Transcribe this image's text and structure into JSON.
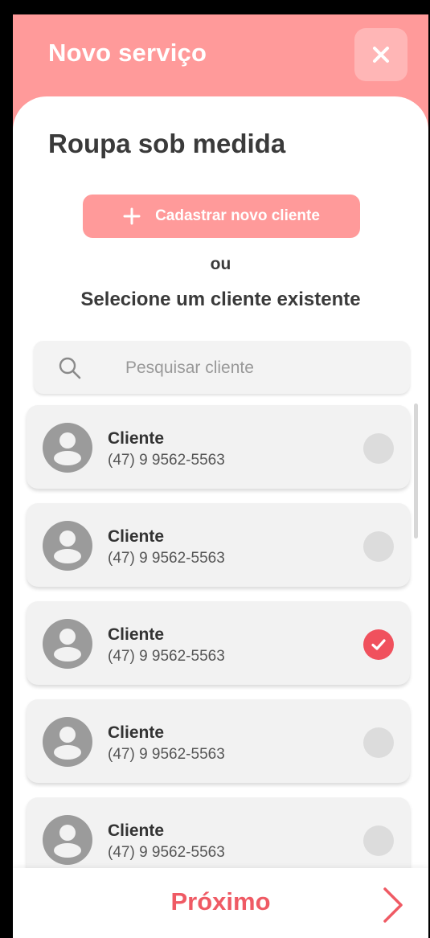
{
  "header": {
    "title": "Novo serviço",
    "close_icon": "close-icon"
  },
  "service": {
    "title": "Roupa sob medida"
  },
  "actions": {
    "add_client_label": "Cadastrar novo cliente",
    "add_icon": "plus-icon",
    "or_text": "ou",
    "select_text": "Selecione um cliente existente"
  },
  "search": {
    "placeholder": "Pesquisar cliente",
    "value": ""
  },
  "clients": [
    {
      "name": "Cliente",
      "phone": "(47) 9 9562-5563",
      "selected": false
    },
    {
      "name": "Cliente",
      "phone": "(47) 9 9562-5563",
      "selected": false
    },
    {
      "name": "Cliente",
      "phone": "(47) 9 9562-5563",
      "selected": true
    },
    {
      "name": "Cliente",
      "phone": "(47) 9 9562-5563",
      "selected": false
    },
    {
      "name": "Cliente",
      "phone": "(47) 9 9562-5563",
      "selected": false
    }
  ],
  "footer": {
    "next_label": "Próximo",
    "next_icon": "chevron-right-icon"
  },
  "colors": {
    "brand_pink": "#ff9a9a",
    "accent_red": "#f0515d",
    "next_text": "#ef5a64"
  }
}
